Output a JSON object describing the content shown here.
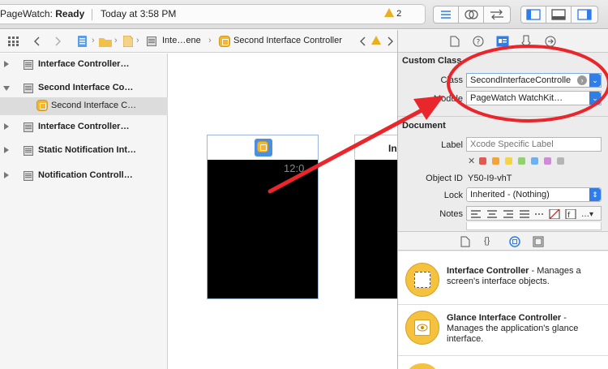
{
  "toolbar": {
    "app_name": "PageWatch:",
    "status": "Ready",
    "timestamp": "Today at 3:58 PM",
    "warning_count": "2"
  },
  "jumpbar": {
    "crumb_scene": "Inte…ene",
    "crumb_controller": "Second Interface Controller"
  },
  "navigator": {
    "items": [
      {
        "label": "Interface Controller…",
        "expanded": false
      },
      {
        "label": "Second Interface Co…",
        "expanded": true
      },
      {
        "label": "Second Interface C…",
        "child": true
      },
      {
        "label": "Interface Controller…",
        "expanded": false
      },
      {
        "label": "Static Notification Int…",
        "expanded": false
      },
      {
        "label": "Notification Controll…",
        "expanded": false
      }
    ]
  },
  "canvas": {
    "watch_time": "12:0",
    "second_scene_title": "In"
  },
  "inspector": {
    "custom_class_title": "Custom Class",
    "class_label": "Class",
    "class_value": "SecondInterfaceControlle",
    "module_label": "Module",
    "module_value": "PageWatch WatchKit…",
    "document_title": "Document",
    "label_label": "Label",
    "label_placeholder": "Xcode Specific Label",
    "object_id_label": "Object ID",
    "object_id_value": "Y50-I9-vhT",
    "lock_label": "Lock",
    "lock_value": "Inherited - (Nothing)",
    "notes_label": "Notes",
    "label_colors": [
      "#e05a4f",
      "#f2a33a",
      "#f5d347",
      "#8fd36a",
      "#6db1f0",
      "#d18ad9",
      "#b5b5b5"
    ]
  },
  "library": {
    "items": [
      {
        "name": "Interface Controller",
        "desc": " - Manages a screen's interface objects."
      },
      {
        "name": "Glance Interface Controller",
        "desc": " - Manages the application's glance interface."
      }
    ]
  },
  "colors": {
    "annotation_red": "#e8262b",
    "accent_blue": "#2f7de9",
    "selection_gray": "#dcdcdc"
  }
}
